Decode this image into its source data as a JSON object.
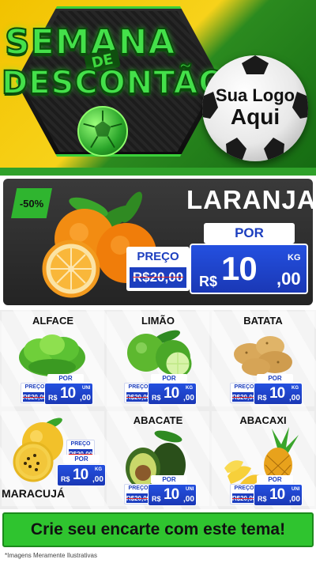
{
  "header": {
    "title_line1": "SEMANA",
    "title_de": "DE",
    "title_line2": "DESCONTÃO",
    "logo_line1": "Sua Logo",
    "logo_line2": "Aqui"
  },
  "highlight": {
    "discount": "-50%",
    "name": "LARANJA",
    "por_label": "POR",
    "preco_label": "PREÇO",
    "old_price": "R$20,00",
    "currency": "R$",
    "price_int": "10",
    "price_dec": ",00",
    "unit": "KG"
  },
  "products": [
    {
      "name": "ALFACE",
      "preco_label": "PREÇO",
      "old_price": "R$20,00",
      "por_label": "POR",
      "currency": "R$",
      "price_int": "10",
      "price_dec": ",00",
      "unit": "UNI"
    },
    {
      "name": "LIMÃO",
      "preco_label": "PREÇO",
      "old_price": "R$20,00",
      "por_label": "POR",
      "currency": "R$",
      "price_int": "10",
      "price_dec": ",00",
      "unit": "KG"
    },
    {
      "name": "BATATA",
      "preco_label": "PREÇO",
      "old_price": "R$20,00",
      "por_label": "POR",
      "currency": "R$",
      "price_int": "10",
      "price_dec": ",00",
      "unit": "KG"
    },
    {
      "name": "MARACUJÁ",
      "preco_label": "PREÇO",
      "old_price": "R$20,00",
      "por_label": "POR",
      "currency": "R$",
      "price_int": "10",
      "price_dec": ",00",
      "unit": "KG"
    },
    {
      "name": "ABACATE",
      "preco_label": "PREÇO",
      "old_price": "R$20,00",
      "por_label": "POR",
      "currency": "R$",
      "price_int": "10",
      "price_dec": ",00",
      "unit": "UNI"
    },
    {
      "name": "ABACAXI",
      "preco_label": "PREÇO",
      "old_price": "R$20,00",
      "por_label": "POR",
      "currency": "R$",
      "price_int": "10",
      "price_dec": ",00",
      "unit": "UNI"
    }
  ],
  "footer": {
    "cta": "Crie seu encarte com este tema!",
    "note": "*Imagens Meramente Ilustrativas"
  },
  "colors": {
    "brand_green": "#2fc42f",
    "brand_yellow": "#f2c200",
    "price_blue": "#1d3fbf",
    "strike_red": "#e02020"
  }
}
